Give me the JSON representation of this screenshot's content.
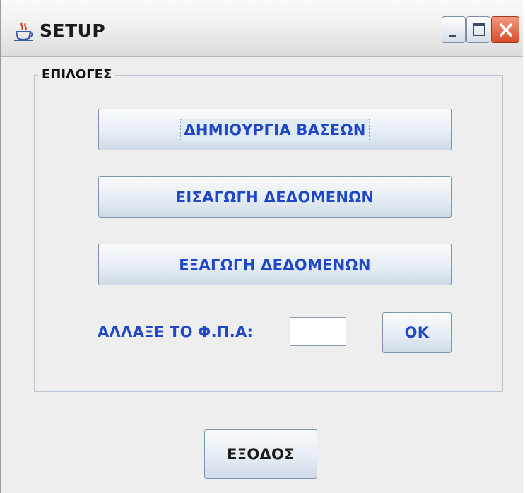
{
  "window": {
    "title": "SETUP",
    "icon": "java-cup-icon",
    "controls": [
      "minimize-icon",
      "maximize-icon",
      "close-icon"
    ]
  },
  "options_group": {
    "legend": "ΕΠΙΛΟΓΕΣ",
    "buttons": {
      "create_db": "ΔΗΜΙΟΥΡΓΙΑ ΒΑΣΕΩΝ",
      "import_data": "ΕΙΣΑΓΩΓΗ ΔΕΔΟΜΕΝΩΝ",
      "export_data": "ΕΞΑΓΩΓΗ ΔΕΔΟΜΕΝΩΝ"
    },
    "vat": {
      "label": "ΑΛΛΑΞΕ ΤΟ Φ.Π.Α:",
      "value": "",
      "ok_label": "OK"
    }
  },
  "exit_label": "ΕΞΟΔΟΣ",
  "colors": {
    "accent_text": "#1f47c8",
    "close_button": "#d84b28",
    "panel_background": "#eeeeee"
  }
}
